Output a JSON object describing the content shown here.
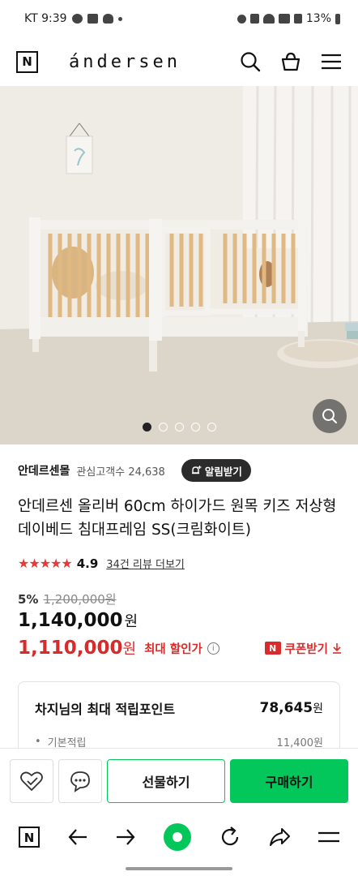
{
  "status_bar": {
    "carrier_time": "KT 9:39",
    "battery": "13%"
  },
  "header": {
    "logo_letter": "N",
    "brand": "ándersen",
    "icons": [
      "search-icon",
      "cart-icon",
      "menu-icon"
    ]
  },
  "gallery": {
    "image_count": 5,
    "active_index": 0
  },
  "seller": {
    "name": "안데르센몰",
    "fav_label": "관심고객수 24,638",
    "alarm_button": "알림받기"
  },
  "product": {
    "title": "안데르센 올리버 60cm 하이가드 원목 키즈 저상형 데이베드 침대프레임 SS(크림화이트)",
    "stars": "★★★★★",
    "rating": "4.9",
    "review_link": "34건 리뷰 더보기",
    "discount_rate": "5%",
    "original_price": "1,200,000원",
    "price": "1,140,000",
    "price_unit": "원",
    "max_price": "1,110,000",
    "max_price_unit": "원",
    "max_label": "최대 할인가",
    "info_glyph": "i",
    "coupon_badge": "N",
    "coupon_label": "쿠폰받기"
  },
  "points": {
    "title": "차지님의 최대 적립포인트",
    "total": "78,645",
    "total_unit": "원",
    "sub_label": "기본적립",
    "sub_value": "11,400원"
  },
  "buy_bar": {
    "gift_button": "선물하기",
    "purchase_button": "구매하기",
    "accent_color": "#03c75a"
  },
  "nav": {
    "logo_letter": "N"
  }
}
